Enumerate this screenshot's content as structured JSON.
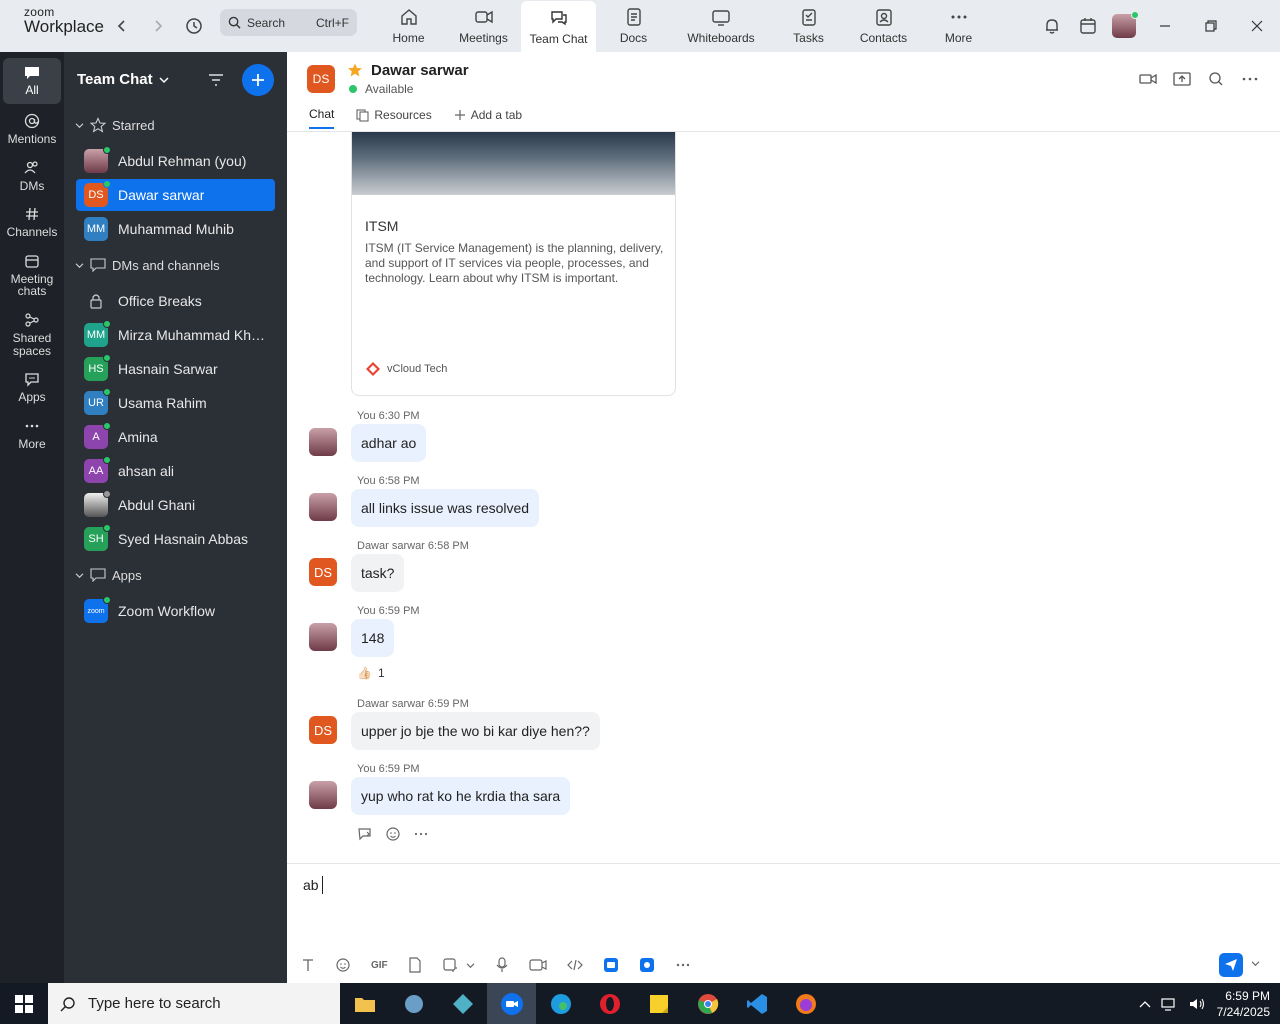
{
  "app": {
    "logo_top": "zoom",
    "logo_bottom": "Workplace"
  },
  "search": {
    "label": "Search",
    "shortcut": "Ctrl+F"
  },
  "topnav": [
    {
      "label": "Home",
      "icon": "home-icon"
    },
    {
      "label": "Meetings",
      "icon": "video-camera-icon"
    },
    {
      "label": "Team Chat",
      "icon": "chat-bubbles-icon",
      "active": true
    },
    {
      "label": "Docs",
      "icon": "document-icon"
    },
    {
      "label": "Whiteboards",
      "icon": "whiteboard-icon"
    },
    {
      "label": "Tasks",
      "icon": "tasks-icon"
    },
    {
      "label": "Contacts",
      "icon": "contacts-icon"
    },
    {
      "label": "More",
      "icon": "more-dots-icon"
    }
  ],
  "rail": [
    {
      "label": "All",
      "icon": "chat-icon",
      "active": true
    },
    {
      "label": "Mentions",
      "icon": "at-icon"
    },
    {
      "label": "DMs",
      "icon": "people-icon"
    },
    {
      "label": "Channels",
      "icon": "hash-icon"
    },
    {
      "label": "Meeting chats",
      "icon": "calendar-icon"
    },
    {
      "label": "Shared spaces",
      "icon": "shared-spaces-icon"
    },
    {
      "label": "Apps",
      "icon": "apps-bubble-icon"
    },
    {
      "label": "More",
      "icon": "more-dots-icon"
    }
  ],
  "sidebar": {
    "title": "Team Chat",
    "sections": {
      "starred": "Starred",
      "dms": "DMs and channels",
      "apps": "Apps"
    },
    "starred": [
      {
        "name": "Abdul Rehman (you)",
        "avatar": "photo",
        "color": "#8a5a6a"
      },
      {
        "name": "Dawar sarwar",
        "avatar": "DS",
        "color": "#e0581f",
        "selected": true
      }
    ],
    "muhib": {
      "name": "Muhammad Muhib",
      "avatar": "MM",
      "color": "#2f7fc1"
    },
    "dms": [
      {
        "name": "Office Breaks",
        "avatar": "lock"
      },
      {
        "name": "Mirza Muhammad Khurram",
        "avatar": "MM",
        "color": "#1fa38a",
        "online": true
      },
      {
        "name": "Hasnain Sarwar",
        "avatar": "HS",
        "color": "#25a15a",
        "online": true
      },
      {
        "name": "Usama Rahim",
        "avatar": "UR",
        "color": "#2f7fc1",
        "online": true
      },
      {
        "name": "Amina",
        "avatar": "A",
        "color": "#8e44ad",
        "online": true
      },
      {
        "name": "ahsan ali",
        "avatar": "AA",
        "color": "#8e44ad",
        "online": true
      },
      {
        "name": "Abdul Ghani",
        "avatar": "photo",
        "color": "#ddd"
      },
      {
        "name": "Syed Hasnain Abbas",
        "avatar": "SH",
        "color": "#25a15a",
        "online": true
      }
    ],
    "apps": [
      {
        "name": "Zoom Workflow",
        "avatar": "zoom",
        "color": "#0e72ed",
        "online": true
      }
    ]
  },
  "chat": {
    "name": "Dawar sarwar",
    "avatar": "DS",
    "status": "Available",
    "tabs": [
      "Chat",
      "Resources",
      "Add a tab"
    ],
    "card": {
      "title": "ITSM",
      "description": "ITSM (IT Service Management) is the planning, delivery, and support of IT services via people, processes, and technology. Learn about why ITSM is important.",
      "source": "vCloud Tech"
    },
    "messages": [
      {
        "sender": "You",
        "time": "6:30 PM",
        "text": "adhar ao",
        "mine": true
      },
      {
        "sender": "You",
        "time": "6:58 PM",
        "text": "all links issue was resolved",
        "mine": true
      },
      {
        "sender": "Dawar sarwar",
        "time": "6:58 PM",
        "text": "task?",
        "mine": false
      },
      {
        "sender": "You",
        "time": "6:59 PM",
        "text": "148",
        "mine": true,
        "reaction": {
          "emoji": "👍🏻",
          "count": "1"
        }
      },
      {
        "sender": "Dawar sarwar",
        "time": "6:59 PM",
        "text": "upper jo bje the wo bi kar diye hen??",
        "mine": false
      },
      {
        "sender": "You",
        "time": "6:59 PM",
        "text": "yup who rat ko he krdia tha sara",
        "mine": true
      }
    ],
    "composer": {
      "value": "ab",
      "gif_label": "GIF"
    }
  },
  "taskbar": {
    "search_placeholder": "Type here to search",
    "time": "6:59 PM",
    "date": "7/24/2025"
  },
  "colors": {
    "accent": "#0e72ed",
    "sidebar": "#2b2f36",
    "rail": "#1e2228",
    "online": "#2ac769"
  }
}
